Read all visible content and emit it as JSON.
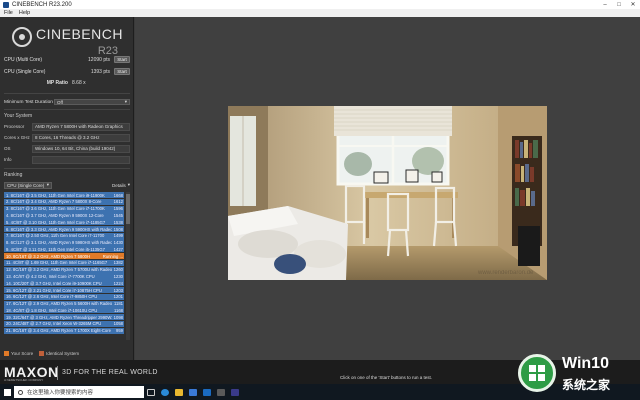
{
  "window": {
    "title": "CINEBENCH R23.200"
  },
  "menu": {
    "file": "File",
    "help": "Help"
  },
  "logo": {
    "brand": "CINEBENCH",
    "version": "R23"
  },
  "benchmarks": {
    "multi": {
      "label": "CPU (Multi Core)",
      "value": "12090 pts",
      "button": "Start"
    },
    "single": {
      "label": "CPU (Single Core)",
      "value": "1393 pts",
      "button": "Start"
    },
    "ratio": {
      "label": "MP Ratio",
      "value": "8.68 x"
    }
  },
  "min_test_duration": {
    "label": "Minimum Test Duration",
    "value": "Off"
  },
  "system": {
    "title": "Your System",
    "processor": {
      "label": "Processor",
      "value": "AMD Ryzen 7 5800H with Radeon Graphics"
    },
    "cores": {
      "label": "Cores x GHz",
      "value": "8 Cores, 16 Threads @ 3.2 GHz"
    },
    "os": {
      "label": "OS",
      "value": "Windows 10, 64 Bit, China (build 19042)"
    },
    "info": {
      "label": "Info",
      "value": ""
    }
  },
  "ranking": {
    "title": "Ranking",
    "selector": "CPU (Single Core)",
    "details": "Details",
    "items": [
      {
        "text": "1. 8C/16T @ 3.5 GHz, 11th Gen Intel Core i9-11900K",
        "score": "1668"
      },
      {
        "text": "2. 8C/16T @ 3.4 GHz, AMD Ryzen 7 5800X 8-Core",
        "score": "1612"
      },
      {
        "text": "3. 8C/16T @ 3.6 GHz, 11th Gen Intel Core i7-11700K",
        "score": "1596"
      },
      {
        "text": "4. 8C/16T @ 3.7 GHz, AMD Ryzen 9 5900X 12-Core",
        "score": "1545"
      },
      {
        "text": "5. 4C/8T @ 3.10 GHz, 11th Gen Intel Core i7-1185G7",
        "score": "1538"
      },
      {
        "text": "6. 8C/16T @ 3.3 GHz, AMD Ryzen 9 5900HX with Radeon",
        "score": "1508"
      },
      {
        "text": "7. 8C/16T @ 2.50 GHz, 11th Gen Intel Core i7-11700",
        "score": "1499"
      },
      {
        "text": "8. 6C/12T @ 3.1 GHz, AMD Ryzen 9 5980HX with Radeon",
        "score": "1430"
      },
      {
        "text": "9. 4C/8T @ 3.11 GHz, 11th Gen Intel Core i5-1135G7",
        "score": "1427"
      },
      {
        "text": "10. 8C/16T @ 3.2 GHz, AMD Ryzen 7 5800H",
        "score": "Running ...",
        "current": true
      },
      {
        "text": "11. 4C/8T @ 1.69 GHz, 11th Gen Intel Core i7-1165G7",
        "score": "1382"
      },
      {
        "text": "12. 8C/16T @ 3.2 GHz, AMD Ryzen 7 5700U with Radeon",
        "score": "1260"
      },
      {
        "text": "13. 4C/8T @ 4.2 GHz, Intel Core i7-7700K CPU",
        "score": "1230"
      },
      {
        "text": "14. 10C/20T @ 3.7 GHz, Intel Core i9-10900K CPU",
        "score": "1224"
      },
      {
        "text": "15. 6C/12T @ 2.21 GHz, Intel Core i7-10875H CPU",
        "score": "1203"
      },
      {
        "text": "16. 6C/12T @ 2.6 GHz, Intel Core i7-9850H CPU",
        "score": "1201"
      },
      {
        "text": "17. 6C/12T @ 2.9 GHz, AMD Ryzen 5 5600H with Radeon",
        "score": "1181"
      },
      {
        "text": "18. 4C/8T @ 1.8 GHz, Intel Core i7-10610U CPU",
        "score": "1168"
      },
      {
        "text": "19. 32C/64T @ 3 GHz, AMD Ryzen Threadripper 2990WX",
        "score": "1098"
      },
      {
        "text": "20. 24C/48T @ 2.7 GHz, Intel Xeon W-3265M CPU",
        "score": "1058"
      },
      {
        "text": "21. 8C/16T @ 3.4 GHz, AMD Ryzen 7 1700X Eight-Core",
        "score": "959"
      }
    ]
  },
  "legend": {
    "your_score": "Your Score",
    "identical": "Identical System"
  },
  "footer": {
    "brand": "MAXON",
    "brand_sub": "A NEMETSCHEK COMPANY",
    "tagline": "3D FOR THE REAL WORLD",
    "status": "Click on one of the 'Start' buttons to run a test."
  },
  "render": {
    "watermark": "www.renderbaron.de"
  },
  "taskbar": {
    "search_placeholder": "在这里输入你要搜索的内容"
  },
  "watermark": {
    "title": "Win10",
    "subtitle": "系统之家"
  },
  "colors": {
    "rank_bar": "#3d72b0",
    "current_bar": "#e07a28",
    "your_score": "#e07a28",
    "identical": "#c0603a"
  }
}
